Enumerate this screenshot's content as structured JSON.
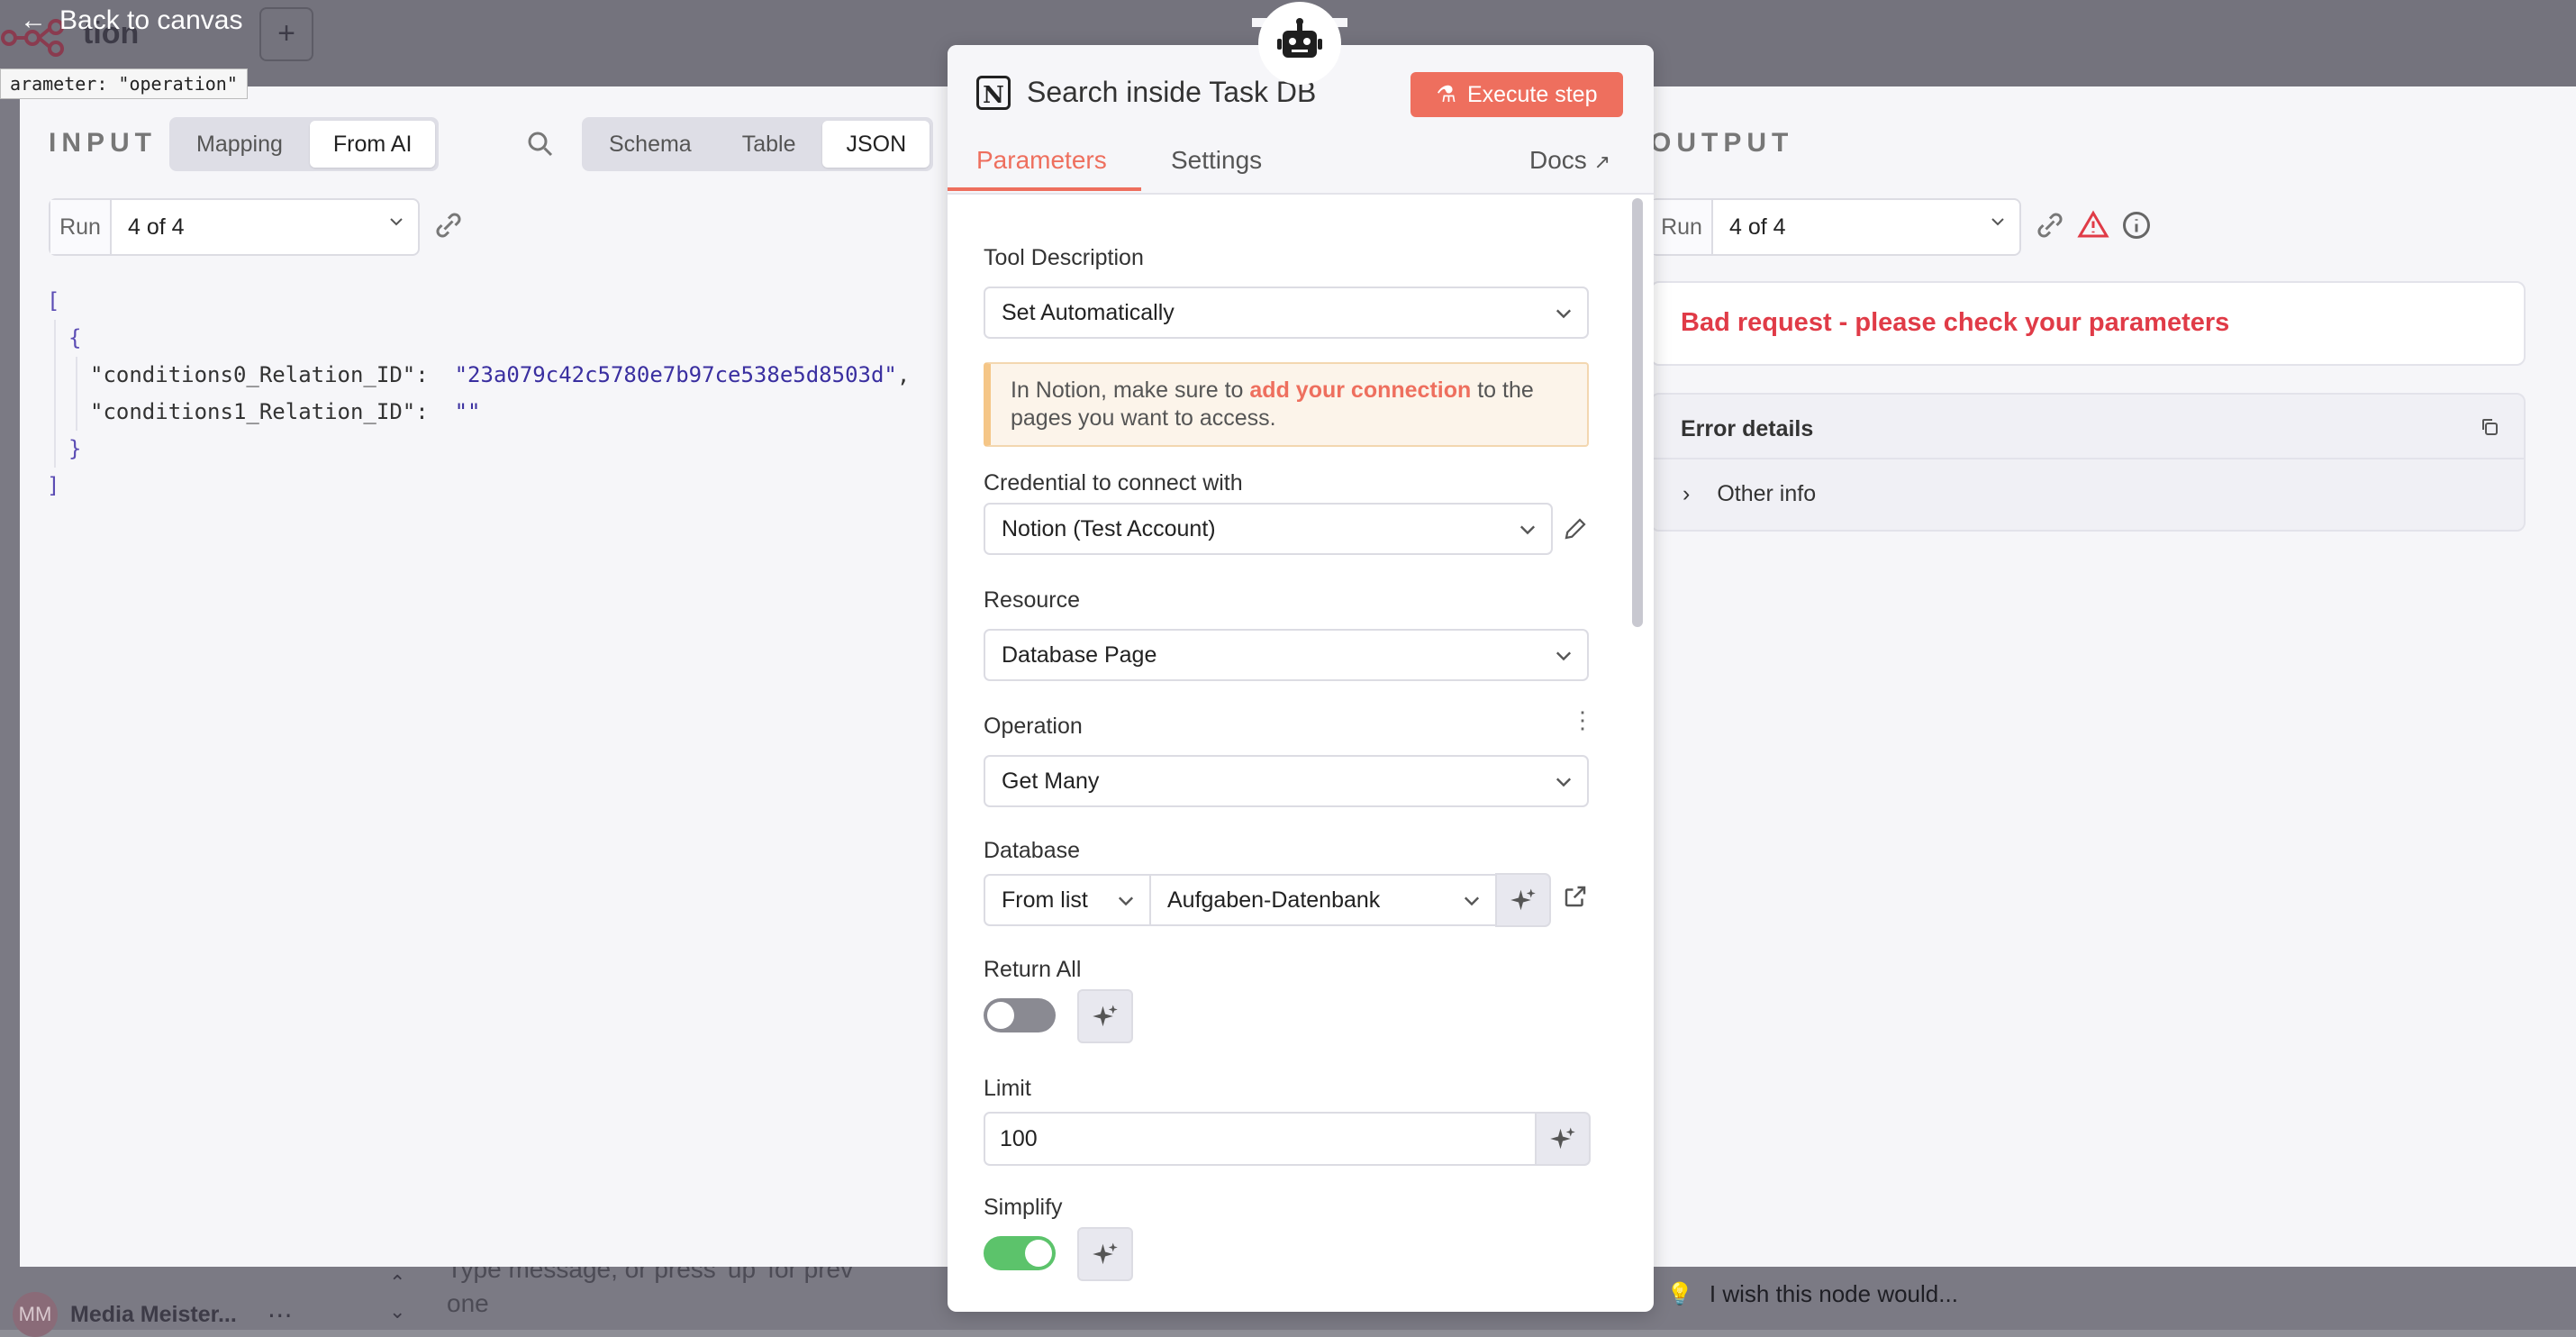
{
  "background": {
    "workflow_title": "tion",
    "user_initials": "MM",
    "user_name": "Media Meister...",
    "chat_placeholder": "Type message, or press 'up' for prev one",
    "wish_text": "I wish this node would..."
  },
  "nav": {
    "back_label": "Back to canvas",
    "tooltip": "arameter: \"operation\""
  },
  "input": {
    "title": "INPUT",
    "mode_options": [
      "Mapping",
      "From AI"
    ],
    "mode_selected": "From AI",
    "view_options": [
      "Schema",
      "Table",
      "JSON"
    ],
    "view_selected": "JSON",
    "run_label": "Run",
    "run_value": "4 of 4",
    "json": {
      "key0": "\"conditions0_Relation_ID\":",
      "val0": "\"23a079c42c5780e7b97ce538e5d8503d\"",
      "key1": "\"conditions1_Relation_ID\":",
      "val1": "\"\""
    }
  },
  "node": {
    "title": "Search inside Task DB",
    "execute_label": "Execute step",
    "tabs": [
      "Parameters",
      "Settings"
    ],
    "active_tab": "Parameters",
    "docs_label": "Docs",
    "fields": {
      "tool_description_label": "Tool Description",
      "tool_description_value": "Set Automatically",
      "notice_prefix": "In Notion, make sure to ",
      "notice_link": "add your connection",
      "notice_suffix": " to the pages you want to access.",
      "credential_label": "Credential to connect with",
      "credential_value": "Notion (Test Account)",
      "resource_label": "Resource",
      "resource_value": "Database Page",
      "operation_label": "Operation",
      "operation_value": "Get Many",
      "database_label": "Database",
      "database_mode": "From list",
      "database_value": "Aufgaben-Datenbank",
      "return_all_label": "Return All",
      "return_all_on": false,
      "limit_label": "Limit",
      "limit_value": "100",
      "simplify_label": "Simplify",
      "simplify_on": true
    }
  },
  "output": {
    "title": "OUTPUT",
    "run_label": "Run",
    "run_value": "4 of 4",
    "error_message": "Bad request - please check your parameters",
    "error_details_label": "Error details",
    "other_info_label": "Other info"
  },
  "colors": {
    "accent": "#ee6f5e",
    "error": "#e03b47",
    "toggle_on": "#5cc36b",
    "toggle_off": "#8a8a92"
  }
}
